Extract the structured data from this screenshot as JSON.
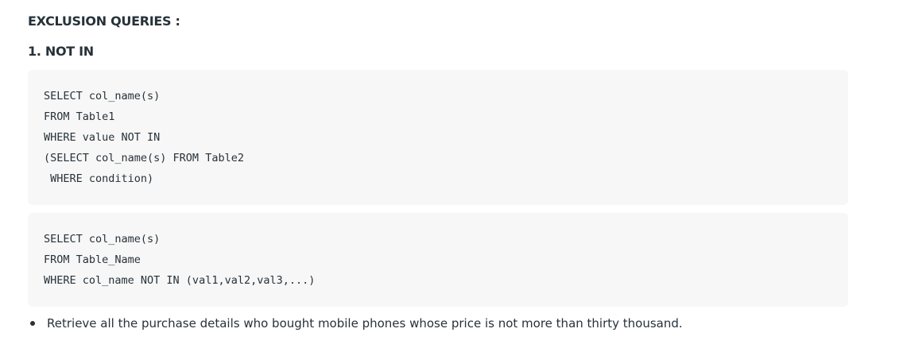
{
  "headings": {
    "section": "EXCLUSION QUERIES :",
    "subsection": "1. NOT IN"
  },
  "code_blocks": [
    {
      "lines": [
        "SELECT col_name(s)",
        "FROM Table1",
        "WHERE value NOT IN",
        "(SELECT col_name(s) FROM Table2",
        " WHERE condition)"
      ]
    },
    {
      "lines": [
        "SELECT col_name(s)",
        "FROM Table_Name",
        "WHERE col_name NOT IN (val1,val2,val3,...)"
      ]
    }
  ],
  "bullets": [
    "Retrieve all the purchase details who bought mobile phones whose price is not more than thirty thousand."
  ],
  "colors": {
    "text": "#273239",
    "code_background": "#f7f7f7"
  }
}
